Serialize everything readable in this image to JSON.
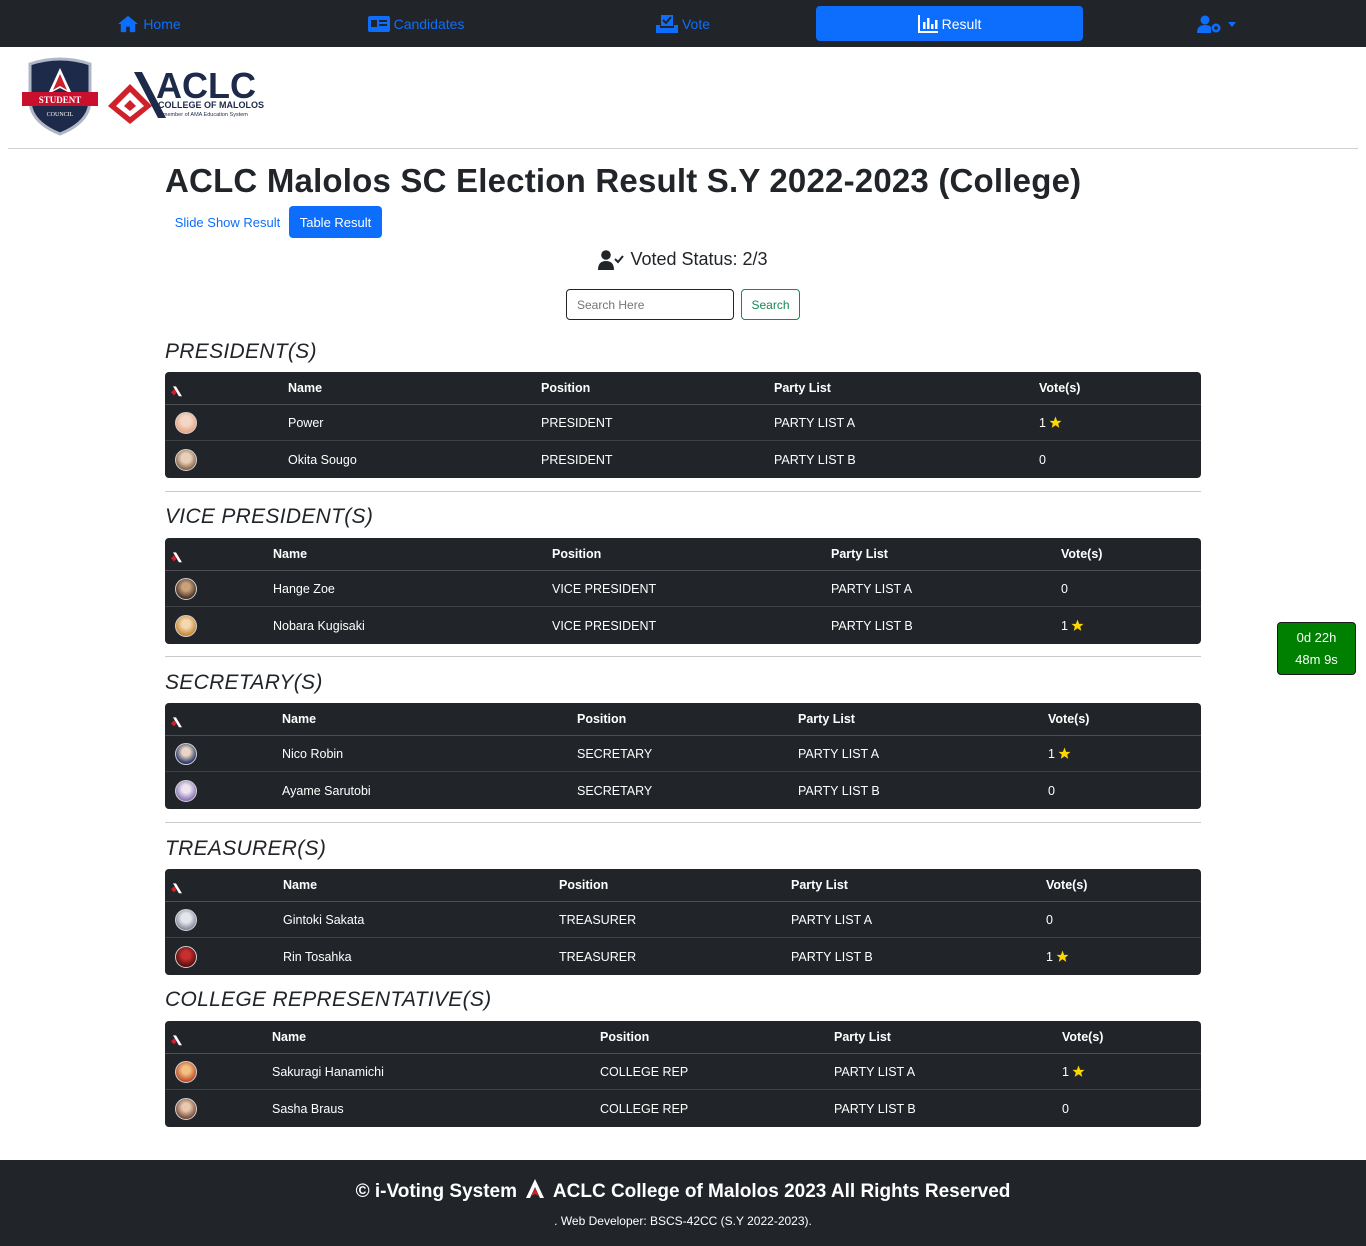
{
  "nav": {
    "home": "Home",
    "candidates": "Candidates",
    "vote": "Vote",
    "result": "Result",
    "user_icon": "user-gear-icon"
  },
  "logos": {
    "student_council_line1": "STUDENT",
    "student_council_line2": "COUNCIL",
    "aclc_big": "ACLC",
    "aclc_college": "COLLEGE OF MALOLOS",
    "aclc_member": "A member of AMA Education System"
  },
  "page_title": "ACLC Malolos SC Election Result S.Y 2022-2023 (College)",
  "tabs": {
    "slide": "Slide Show Result",
    "table": "Table Result"
  },
  "voted_status": "Voted Status: 2/3",
  "search": {
    "placeholder": "Search Here",
    "button": "Search"
  },
  "columns": {
    "name": "Name",
    "position": "Position",
    "party": "Party List",
    "votes": "Vote(s)"
  },
  "sections": [
    {
      "title": "PRESIDENT(S)",
      "rows": [
        {
          "name": "Power",
          "position": "PRESIDENT",
          "party": "PARTY LIST A",
          "votes": "1",
          "star": true
        },
        {
          "name": "Okita Sougo",
          "position": "PRESIDENT",
          "party": "PARTY LIST B",
          "votes": "0",
          "star": false
        }
      ]
    },
    {
      "title": "VICE PRESIDENT(S)",
      "rows": [
        {
          "name": "Hange Zoe",
          "position": "VICE PRESIDENT",
          "party": "PARTY LIST A",
          "votes": "0",
          "star": false
        },
        {
          "name": "Nobara Kugisaki",
          "position": "VICE PRESIDENT",
          "party": "PARTY LIST B",
          "votes": "1",
          "star": true
        }
      ]
    },
    {
      "title": "SECRETARY(S)",
      "rows": [
        {
          "name": "Nico Robin",
          "position": "SECRETARY",
          "party": "PARTY LIST A",
          "votes": "1",
          "star": true
        },
        {
          "name": "Ayame Sarutobi",
          "position": "SECRETARY",
          "party": "PARTY LIST B",
          "votes": "0",
          "star": false
        }
      ]
    },
    {
      "title": "TREASURER(S)",
      "rows": [
        {
          "name": "Gintoki Sakata",
          "position": "TREASURER",
          "party": "PARTY LIST A",
          "votes": "0",
          "star": false
        },
        {
          "name": "Rin Tosahka",
          "position": "TREASURER",
          "party": "PARTY LIST B",
          "votes": "1",
          "star": true
        }
      ]
    },
    {
      "title": "COLLEGE REPRESENTATIVE(S)",
      "rows": [
        {
          "name": "Sakuragi Hanamichi",
          "position": "COLLEGE REP",
          "party": "PARTY LIST A",
          "votes": "1",
          "star": true
        },
        {
          "name": "Sasha Braus",
          "position": "COLLEGE REP",
          "party": "PARTY LIST B",
          "votes": "0",
          "star": false
        }
      ]
    }
  ],
  "timer": {
    "line1": "0d 22h",
    "line2": "48m 9s"
  },
  "footer": {
    "main_left": "© i-Voting System",
    "main_right": "ACLC College of Malolos 2023 All Rights Reserved",
    "sub": ". Web Developer: BSCS-42CC (S.Y 2022-2023)."
  },
  "colors": {
    "accent": "#0d6efd",
    "dark": "#212529",
    "success": "#198754",
    "timer_bg": "#008000",
    "star": "#ffd700"
  }
}
